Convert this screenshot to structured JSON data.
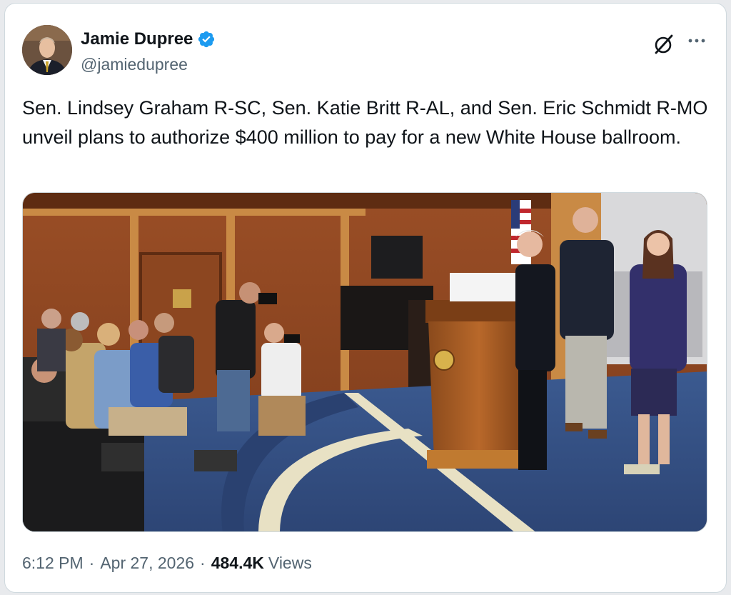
{
  "author": {
    "display_name": "Jamie Dupree",
    "handle": "@jamiedupree",
    "verified": true
  },
  "tweet": {
    "text": "Sen. Lindsey Graham R-SC, Sen. Katie Britt R-AL, and Sen. Eric Schmidt R-MO unveil plans to authorize $400 million to pay for a new White House ballroom."
  },
  "meta": {
    "time": "6:12 PM",
    "separator": "·",
    "date": "Apr 27, 2026",
    "views_count": "484.4K",
    "views_label": "Views"
  },
  "colors": {
    "verified_blue": "#1d9bf0",
    "secondary_text": "#536471",
    "primary_text": "#0f1419"
  },
  "icons": {
    "grok": "grok-icon",
    "more": "more-icon",
    "verified": "verified-badge-icon"
  }
}
